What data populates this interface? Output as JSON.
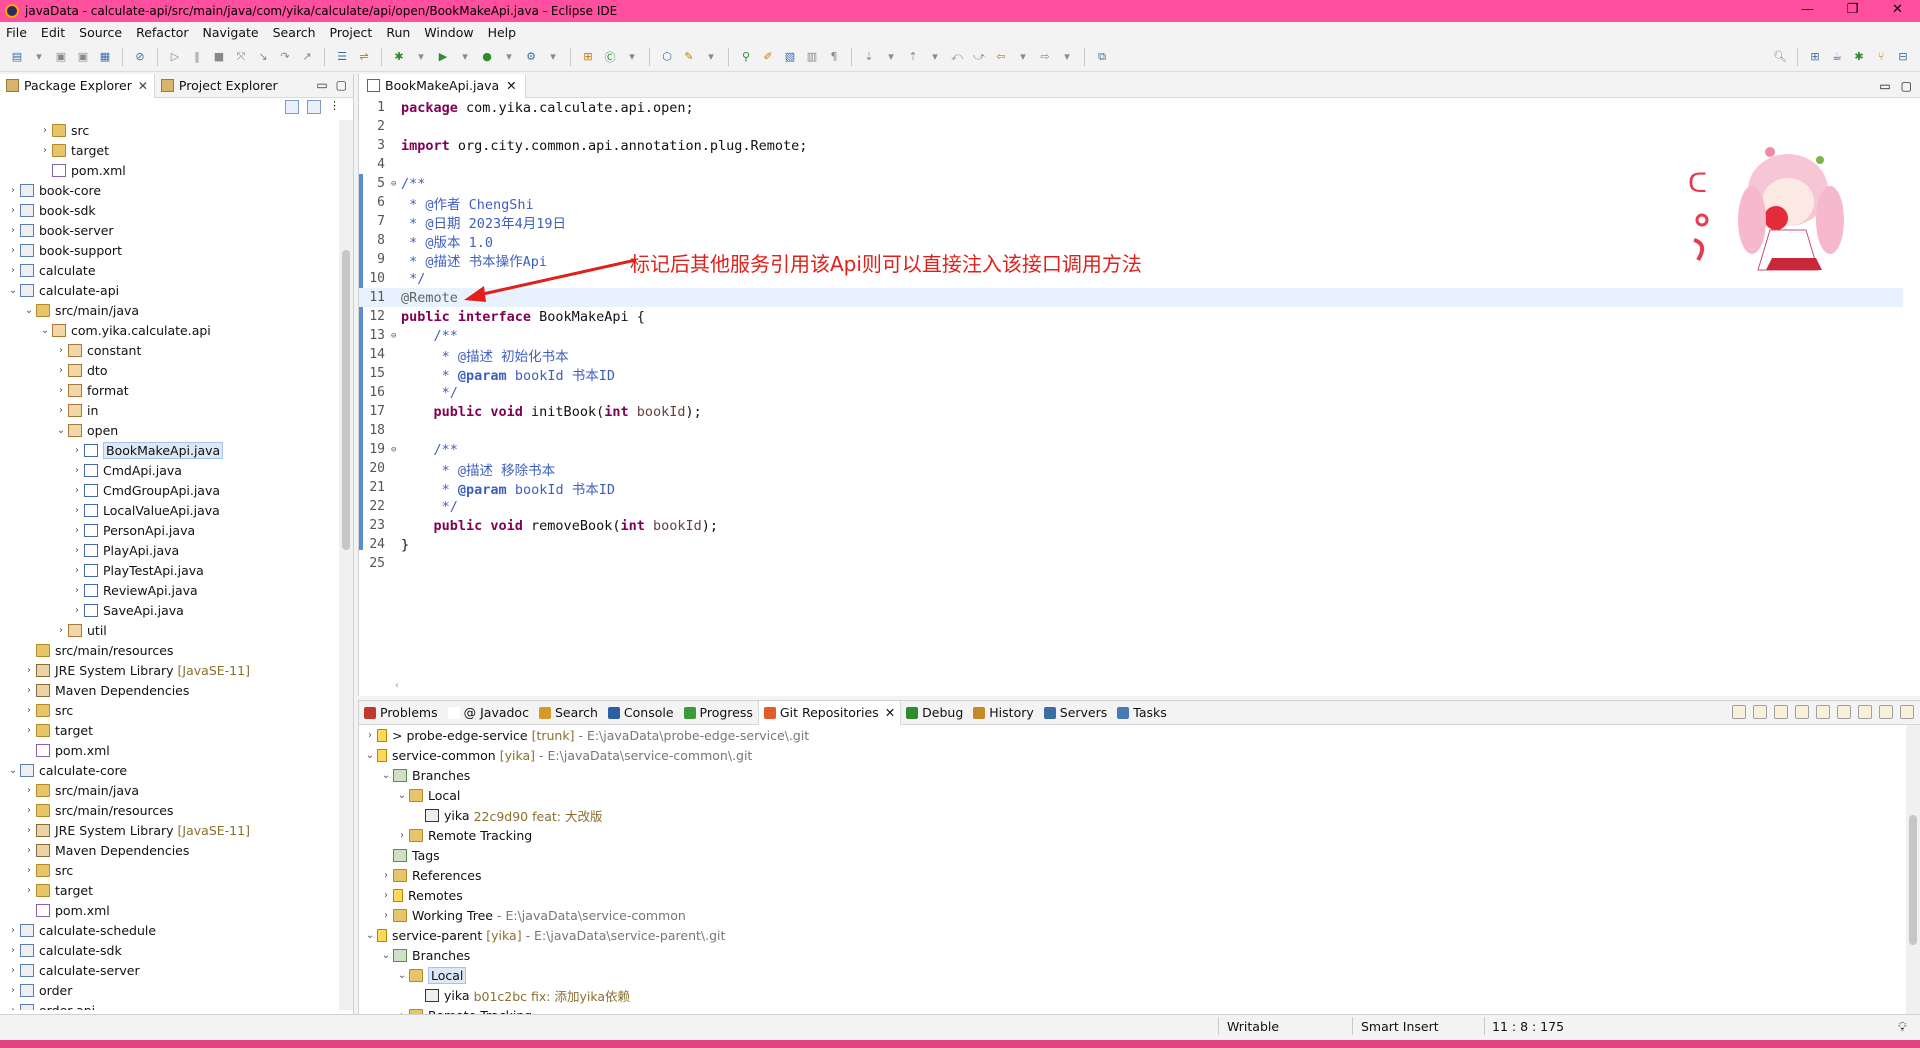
{
  "window": {
    "title": "javaData - calculate-api/src/main/java/com/yika/calculate/api/open/BookMakeApi.java - Eclipse IDE",
    "controls": [
      "—",
      "❐",
      "✕"
    ]
  },
  "menu": [
    "File",
    "Edit",
    "Source",
    "Refactor",
    "Navigate",
    "Search",
    "Project",
    "Run",
    "Window",
    "Help"
  ],
  "left_panel": {
    "tabs": [
      {
        "label": "Package Explorer",
        "active": true
      },
      {
        "label": "Project Explorer",
        "active": false
      }
    ],
    "tree": [
      {
        "indent": 2,
        "twisty": "›",
        "icon": "folder",
        "label": "src"
      },
      {
        "indent": 2,
        "twisty": "›",
        "icon": "folder",
        "label": "target"
      },
      {
        "indent": 2,
        "twisty": "",
        "icon": "xml",
        "label": "pom.xml"
      },
      {
        "indent": 0,
        "twisty": "›",
        "icon": "proj",
        "label": "book-core"
      },
      {
        "indent": 0,
        "twisty": "›",
        "icon": "proj",
        "label": "book-sdk"
      },
      {
        "indent": 0,
        "twisty": "›",
        "icon": "proj",
        "label": "book-server"
      },
      {
        "indent": 0,
        "twisty": "›",
        "icon": "proj",
        "label": "book-support"
      },
      {
        "indent": 0,
        "twisty": "›",
        "icon": "proj",
        "label": "calculate"
      },
      {
        "indent": 0,
        "twisty": "⌄",
        "icon": "proj",
        "label": "calculate-api"
      },
      {
        "indent": 1,
        "twisty": "⌄",
        "icon": "folder",
        "label": "src/main/java"
      },
      {
        "indent": 2,
        "twisty": "⌄",
        "icon": "pkg",
        "label": "com.yika.calculate.api"
      },
      {
        "indent": 3,
        "twisty": "›",
        "icon": "pkg",
        "label": "constant"
      },
      {
        "indent": 3,
        "twisty": "›",
        "icon": "pkg",
        "label": "dto"
      },
      {
        "indent": 3,
        "twisty": "›",
        "icon": "pkg",
        "label": "format"
      },
      {
        "indent": 3,
        "twisty": "›",
        "icon": "pkg",
        "label": "in"
      },
      {
        "indent": 3,
        "twisty": "⌄",
        "icon": "pkg",
        "label": "open"
      },
      {
        "indent": 4,
        "twisty": "›",
        "icon": "java",
        "label": "BookMakeApi.java",
        "selected": true
      },
      {
        "indent": 4,
        "twisty": "›",
        "icon": "java",
        "label": "CmdApi.java"
      },
      {
        "indent": 4,
        "twisty": "›",
        "icon": "java",
        "label": "CmdGroupApi.java"
      },
      {
        "indent": 4,
        "twisty": "›",
        "icon": "java",
        "label": "LocalValueApi.java"
      },
      {
        "indent": 4,
        "twisty": "›",
        "icon": "java",
        "label": "PersonApi.java"
      },
      {
        "indent": 4,
        "twisty": "›",
        "icon": "java",
        "label": "PlayApi.java"
      },
      {
        "indent": 4,
        "twisty": "›",
        "icon": "java",
        "label": "PlayTestApi.java"
      },
      {
        "indent": 4,
        "twisty": "›",
        "icon": "java",
        "label": "ReviewApi.java"
      },
      {
        "indent": 4,
        "twisty": "›",
        "icon": "java",
        "label": "SaveApi.java"
      },
      {
        "indent": 3,
        "twisty": "›",
        "icon": "pkg",
        "label": "util"
      },
      {
        "indent": 1,
        "twisty": "",
        "icon": "folder",
        "label": "src/main/resources"
      },
      {
        "indent": 1,
        "twisty": "›",
        "icon": "lib",
        "label": "JRE System Library",
        "decoration": "[JavaSE-11]"
      },
      {
        "indent": 1,
        "twisty": "›",
        "icon": "lib",
        "label": "Maven Dependencies"
      },
      {
        "indent": 1,
        "twisty": "›",
        "icon": "folder",
        "label": "src"
      },
      {
        "indent": 1,
        "twisty": "›",
        "icon": "folder",
        "label": "target"
      },
      {
        "indent": 1,
        "twisty": "",
        "icon": "xml",
        "label": "pom.xml"
      },
      {
        "indent": 0,
        "twisty": "⌄",
        "icon": "proj",
        "label": "calculate-core"
      },
      {
        "indent": 1,
        "twisty": "›",
        "icon": "folder",
        "label": "src/main/java"
      },
      {
        "indent": 1,
        "twisty": "›",
        "icon": "folder",
        "label": "src/main/resources"
      },
      {
        "indent": 1,
        "twisty": "›",
        "icon": "lib",
        "label": "JRE System Library",
        "decoration": "[JavaSE-11]"
      },
      {
        "indent": 1,
        "twisty": "›",
        "icon": "lib",
        "label": "Maven Dependencies"
      },
      {
        "indent": 1,
        "twisty": "›",
        "icon": "folder",
        "label": "src"
      },
      {
        "indent": 1,
        "twisty": "›",
        "icon": "folder",
        "label": "target"
      },
      {
        "indent": 1,
        "twisty": "",
        "icon": "xml",
        "label": "pom.xml"
      },
      {
        "indent": 0,
        "twisty": "›",
        "icon": "proj",
        "label": "calculate-schedule"
      },
      {
        "indent": 0,
        "twisty": "›",
        "icon": "proj",
        "label": "calculate-sdk"
      },
      {
        "indent": 0,
        "twisty": "›",
        "icon": "proj",
        "label": "calculate-server"
      },
      {
        "indent": 0,
        "twisty": "›",
        "icon": "proj",
        "label": "order"
      },
      {
        "indent": 0,
        "twisty": "›",
        "icon": "proj",
        "label": "order-api"
      }
    ]
  },
  "editor": {
    "tab_label": "BookMakeApi.java",
    "current_line": 11,
    "lines": [
      {
        "n": "1",
        "html": "<span class=\"kw\">package</span> com.yika.calculate.api.open;"
      },
      {
        "n": "2",
        "html": ""
      },
      {
        "n": "3",
        "html": "<span class=\"kw\">import</span> org.city.common.api.annotation.plug.Remote;"
      },
      {
        "n": "4",
        "html": ""
      },
      {
        "n": "5",
        "fold": "⊖",
        "html": "<span class=\"cm\">/**</span>"
      },
      {
        "n": "6",
        "html": "<span class=\"cm\"> * @作者 ChengShi</span>"
      },
      {
        "n": "7",
        "html": "<span class=\"cm\"> * @日期 2023年4月19日</span>"
      },
      {
        "n": "8",
        "html": "<span class=\"cm\"> * @版本 1.0</span>"
      },
      {
        "n": "9",
        "html": "<span class=\"cm\"> * @描述 书本操作Api</span>"
      },
      {
        "n": "10",
        "html": "<span class=\"cm\"> */</span>"
      },
      {
        "n": "11",
        "html": "<span class=\"an\">@Remote</span>"
      },
      {
        "n": "12",
        "html": "<span class=\"kw\">public interface</span> BookMakeApi {"
      },
      {
        "n": "13",
        "fold": "⊖",
        "html": "    <span class=\"cm\">/**</span>"
      },
      {
        "n": "14",
        "html": "<span class=\"cm\">     * @描述 初始化书本</span>"
      },
      {
        "n": "15",
        "html": "<span class=\"cm\">     * <b>@param</b> bookId 书本ID</span>"
      },
      {
        "n": "16",
        "html": "<span class=\"cm\">     */</span>"
      },
      {
        "n": "17",
        "html": "    <span class=\"kw\">public void</span> initBook(<span class=\"kw\">int</span> <span class=\"pm\">bookId</span>);"
      },
      {
        "n": "18",
        "html": ""
      },
      {
        "n": "19",
        "fold": "⊖",
        "html": "    <span class=\"cm\">/**</span>"
      },
      {
        "n": "20",
        "html": "<span class=\"cm\">     * @描述 移除书本</span>"
      },
      {
        "n": "21",
        "html": "<span class=\"cm\">     * <b>@param</b> bookId 书本ID</span>"
      },
      {
        "n": "22",
        "html": "<span class=\"cm\">     */</span>"
      },
      {
        "n": "23",
        "html": "    <span class=\"kw\">public void</span> removeBook(<span class=\"kw\">int</span> <span class=\"pm\">bookId</span>);"
      },
      {
        "n": "24",
        "html": "}"
      },
      {
        "n": "25",
        "html": ""
      }
    ],
    "annotation_text": "标记后其他服务引用该Api则可以直接注入该接口调用方法",
    "annotation_color": "#e0201a"
  },
  "bottom_panel": {
    "tabs": [
      {
        "label": "Problems",
        "color": "#c0392b"
      },
      {
        "label": "@ Javadoc",
        "color": "#ffffff"
      },
      {
        "label": "Search",
        "color": "#d49a2a"
      },
      {
        "label": "Console",
        "color": "#2b5fa8"
      },
      {
        "label": "Progress",
        "color": "#3c9a3c"
      },
      {
        "label": "Git Repositories",
        "color": "#e25c2a",
        "active": true
      },
      {
        "label": "Debug",
        "color": "#2e8b2e"
      },
      {
        "label": "History",
        "color": "#c48a28"
      },
      {
        "label": "Servers",
        "color": "#3a6ea5"
      },
      {
        "label": "Tasks",
        "color": "#4a7ab5"
      }
    ],
    "git_tree": [
      {
        "indent": 0,
        "twisty": "›",
        "icon": "repo",
        "label": "> probe-edge-service",
        "dec": "[trunk]",
        "path": "- E:\\javaData\\probe-edge-service\\.git"
      },
      {
        "indent": 0,
        "twisty": "⌄",
        "icon": "repo",
        "label": "service-common",
        "dec": "[yika]",
        "path": "- E:\\javaData\\service-common\\.git"
      },
      {
        "indent": 1,
        "twisty": "⌄",
        "icon": "branch",
        "label": "Branches"
      },
      {
        "indent": 2,
        "twisty": "⌄",
        "icon": "folder",
        "label": "Local"
      },
      {
        "indent": 3,
        "twisty": "",
        "icon": "commit",
        "label": "yika",
        "dec": "22c9d90 feat: 大改版"
      },
      {
        "indent": 2,
        "twisty": "›",
        "icon": "folder",
        "label": "Remote Tracking"
      },
      {
        "indent": 1,
        "twisty": "",
        "icon": "branch",
        "label": "Tags"
      },
      {
        "indent": 1,
        "twisty": "›",
        "icon": "folder",
        "label": "References"
      },
      {
        "indent": 1,
        "twisty": "›",
        "icon": "repo",
        "label": "Remotes"
      },
      {
        "indent": 1,
        "twisty": "›",
        "icon": "folder",
        "label": "Working Tree",
        "path": "- E:\\javaData\\service-common"
      },
      {
        "indent": 0,
        "twisty": "⌄",
        "icon": "repo",
        "label": "service-parent",
        "dec": "[yika]",
        "path": "- E:\\javaData\\service-parent\\.git"
      },
      {
        "indent": 1,
        "twisty": "⌄",
        "icon": "branch",
        "label": "Branches"
      },
      {
        "indent": 2,
        "twisty": "⌄",
        "icon": "folder",
        "label": "Local",
        "selected": true
      },
      {
        "indent": 3,
        "twisty": "",
        "icon": "commit",
        "label": "yika",
        "dec": "b01c2bc fix: 添加yika依赖"
      },
      {
        "indent": 2,
        "twisty": "›",
        "icon": "folder",
        "label": "Remote Tracking"
      }
    ]
  },
  "status": {
    "writable": "Writable",
    "insert_mode": "Smart Insert",
    "position": "11 : 8 : 175"
  }
}
